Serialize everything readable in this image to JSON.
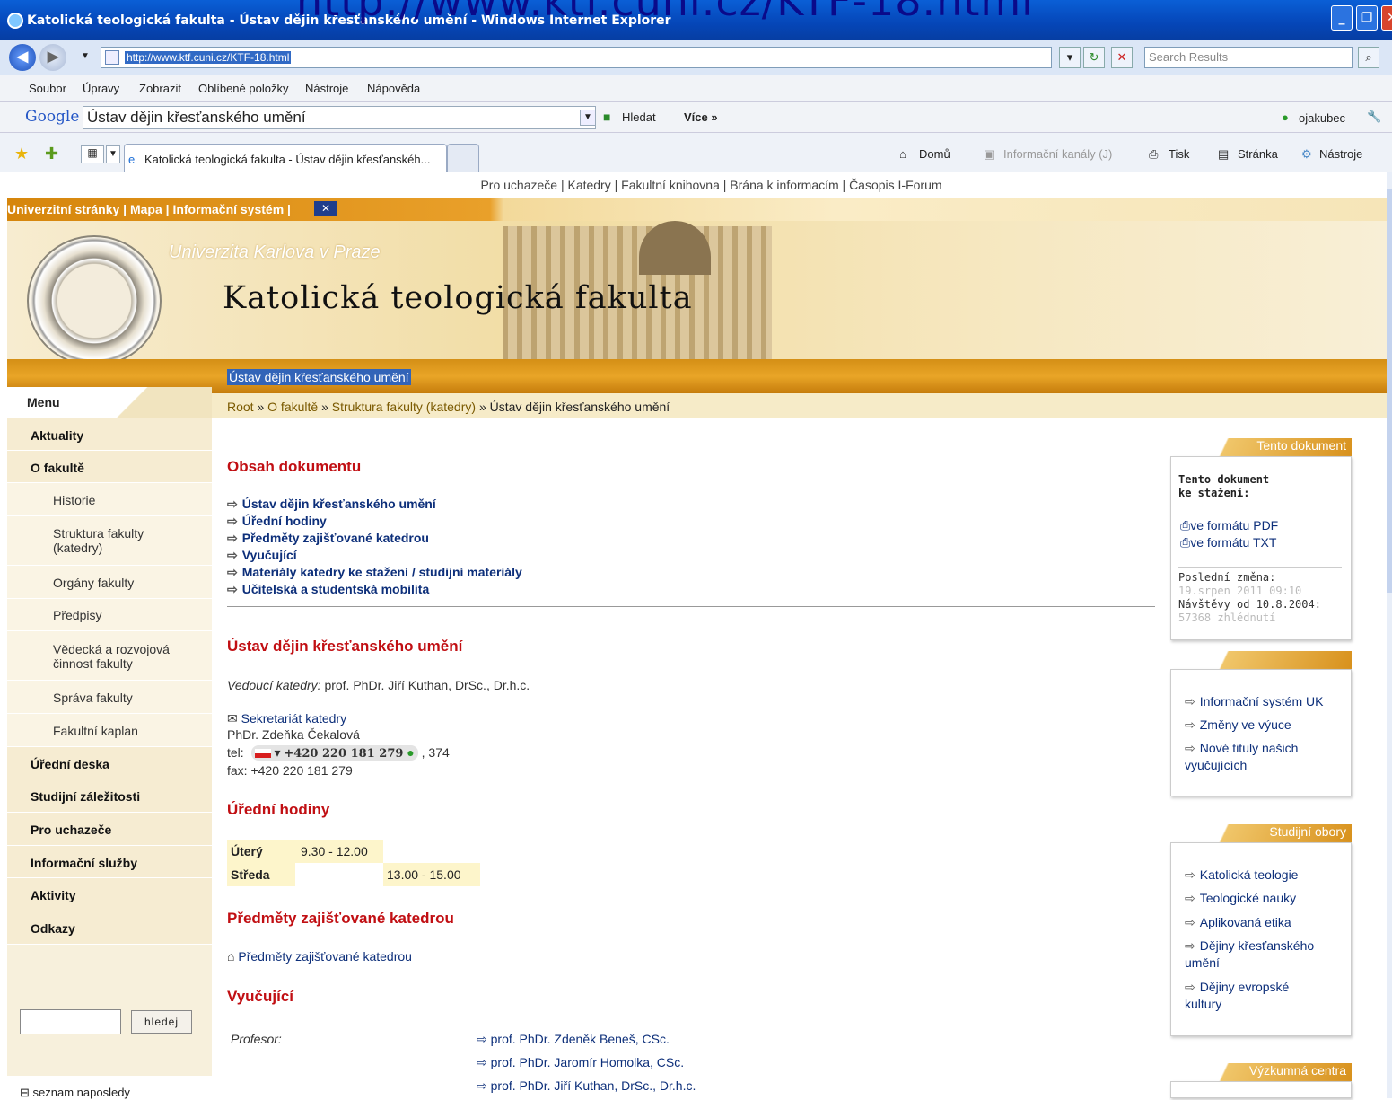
{
  "overlay_url": "http://www.ktf.cuni.cz/KTF-18.html",
  "browser": {
    "title": "Katolická teologická fakulta - Ústav dějin křesťanského umění - Windows Internet Explorer",
    "url": "http://www.ktf.cuni.cz/KTF-18.html",
    "search_placeholder": "Search Results",
    "menu": [
      "Soubor",
      "Úpravy",
      "Zobrazit",
      "Oblíbené položky",
      "Nástroje",
      "Nápověda"
    ],
    "google_logo": "Google",
    "google_query": "Ústav dějin křesťanského umění",
    "google_search": "Hledat",
    "google_more": "Více »",
    "google_user": "ojakubec",
    "tab_title": "Katolická teologická fakulta - Ústav dějin křesťanskéh...",
    "cmd": {
      "home": "Domů",
      "feeds": "Informační kanály (J)",
      "print": "Tisk",
      "page": "Stránka",
      "tools": "Nástroje"
    }
  },
  "page": {
    "topnav": "Pro uchazeče | Katedry | Fakultní knihovna | Brána k informacím | Časopis I-Forum",
    "orange_links": "Univerzitní stránky | Mapa | Informační systém |",
    "university": "Univerzita Karlova v Praze",
    "faculty": "Katolická teologická fakulta",
    "section_title": "Ústav dějin křesťanského umění",
    "menu_header": "Menu",
    "breadcrumb": {
      "root": "Root",
      "sep": "»",
      "b1": "O fakultě",
      "b2": "Struktura fakulty (katedry)",
      "current": "Ústav dějin křesťanského umění"
    },
    "menu": [
      {
        "label": "Aktuality"
      },
      {
        "label": "O fakultě"
      },
      {
        "label": "Historie"
      },
      {
        "label": "Struktura fakulty (katedry)"
      },
      {
        "label": "Orgány fakulty"
      },
      {
        "label": "Předpisy"
      },
      {
        "label": "Vědecká a rozvojová činnost fakulty"
      },
      {
        "label": "Správa fakulty"
      },
      {
        "label": "Fakultní kaplan"
      },
      {
        "label": "Úřední deska"
      },
      {
        "label": "Studijní záležitosti"
      },
      {
        "label": "Pro uchazeče"
      },
      {
        "label": "Informační služby"
      },
      {
        "label": "Aktivity"
      },
      {
        "label": "Odkazy"
      }
    ],
    "search_button": "hledej",
    "recent": "seznam naposledy",
    "contents_heading": "Obsah dokumentu",
    "toc": [
      "Ústav dějin křesťanského umění",
      "Úřední hodiny",
      "Předměty zajišťované katedrou",
      "Vyučující",
      "Materiály katedry ke stažení / studijní materiály",
      "Učitelská a studentská mobilita"
    ],
    "section1_heading": "Ústav dějin křesťanského umění",
    "head_label": "Vedoucí katedry:",
    "head_name": "prof. PhDr. Jiří Kuthan, DrSc., Dr.h.c.",
    "secretariat": "Sekretariát katedry",
    "secretary": "PhDr. Zdeňka Čekalová",
    "tel_label": "tel:",
    "tel_number": "+420 220 181 279",
    "tel_ext": ", 374",
    "fax": "fax: +420 220 181 279",
    "hours_heading": "Úřední hodiny",
    "hours": [
      {
        "day": "Úterý",
        "time1": "9.30 - 12.00",
        "time2": ""
      },
      {
        "day": "Středa",
        "time1": "",
        "time2": "13.00 - 15.00"
      }
    ],
    "subjects_heading": "Předměty zajišťované katedrou",
    "subjects_link": "Předměty zajišťované katedrou",
    "teachers_heading": "Vyučující",
    "prof_label": "Profesor:",
    "professors": [
      "prof. PhDr. Zdeněk Beneš, CSc.",
      "prof. PhDr. Jaromír Homolka, CSc.",
      "prof. PhDr. Jiří Kuthan, DrSc., Dr.h.c."
    ]
  },
  "right": {
    "doc_head": "Tento dokument",
    "doc_title1": "Tento dokument",
    "doc_title2": "ke stažení:",
    "pdf": "ve formátu PDF",
    "txt": "ve formátu TXT",
    "last_change_label": "Poslední změna:",
    "last_change": "19.srpen 2011 09:10",
    "visits_label": "Návštěvy od 10.8.2004:",
    "visits": "57368 zhlédnutí",
    "links": [
      "Informační systém UK",
      "Změny ve výuce",
      "Nové tituly našich vyučujících"
    ],
    "obory_head": "Studijní obory",
    "obory": [
      "Katolická teologie",
      "Teologické nauky",
      "Aplikovaná etika",
      "Dějiny křesťanského umění",
      "Dějiny evropské kultury"
    ],
    "research_head": "Výzkumná centra"
  }
}
